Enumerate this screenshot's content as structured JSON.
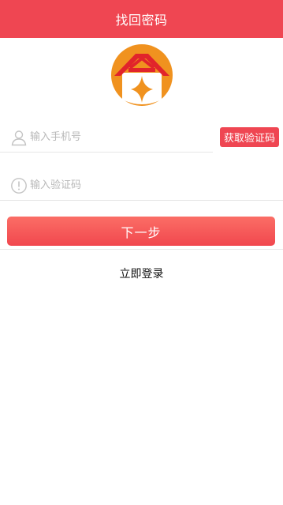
{
  "header": {
    "title": "找回密码"
  },
  "logo": {
    "icon": "app-logo",
    "colors": {
      "circle": "#f0921f",
      "roof": "#e1242b",
      "body": "#ffffff",
      "star": "#f0921f"
    }
  },
  "form": {
    "phone": {
      "icon": "user-icon",
      "placeholder": "输入手机号",
      "value": ""
    },
    "get_code_label": "获取验证码",
    "code": {
      "icon": "info-icon",
      "placeholder": "输入验证码",
      "value": ""
    },
    "next_label": "下一步"
  },
  "footer": {
    "login_label": "立即登录"
  },
  "colors": {
    "brand": "#ef4652",
    "button_gradient_top": "#fb6e66",
    "button_gradient_bottom": "#f1474e",
    "placeholder": "#b9b9b9",
    "divider": "#e6e6e6"
  }
}
